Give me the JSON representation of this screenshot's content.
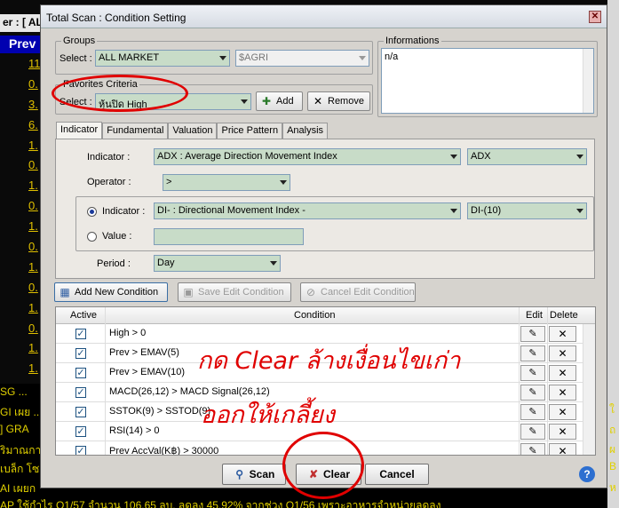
{
  "background": {
    "header_label": "er : [ AL",
    "prev_header": "Prev",
    "values": [
      "11.",
      "0.",
      "3.",
      "6.",
      "1.",
      "0.",
      "1.",
      "0.",
      "1.",
      "0.",
      "1.",
      "0.",
      "1.",
      "0.",
      "1.",
      "1."
    ],
    "news_lines": [
      "SG ...",
      "GI เผย ...",
      "] GRA",
      "ริมาณกา",
      "เบล็ก โซ",
      "AI เผยก",
      "AP ใช้กำไร Q1/57 จำนวน 106.65 ลบ. ลดลง 45.92% จากช่วง Q1/56 เพราะอาหารจำหน่ายลดลง"
    ],
    "right_news": [
      "ใ",
      "ถ",
      "ผ",
      "B",
      "ห"
    ]
  },
  "dialog": {
    "title": "Total Scan : Condition Setting",
    "close_glyph": "✕",
    "groups": {
      "title": "Groups",
      "select_label": "Select :",
      "market_value": "ALL MARKET",
      "sub_value": "$AGRI"
    },
    "informations": {
      "title": "Informations",
      "text": "n/a"
    },
    "favorites": {
      "title": "Favorites Criteria",
      "select_label": "Select :",
      "value": "หุ้นปิด High",
      "add_label": "Add",
      "remove_label": "Remove"
    },
    "tabs": [
      "Indicator",
      "Fundamental",
      "Valuation",
      "Price Pattern",
      "Analysis"
    ],
    "indicator_tab": {
      "indicator_label": "Indicator :",
      "indicator_value": "ADX : Average Direction Movement Index",
      "indicator_param": "ADX",
      "operator_label": "Operator :",
      "operator_value": ">",
      "radio_indicator_label": "Indicator :",
      "compare_indicator_value": "DI- : Directional Movement Index -",
      "compare_indicator_param": "DI-(10)",
      "radio_value_label": "Value :",
      "value_field": "",
      "period_label": "Period :",
      "period_value": "Day"
    },
    "actions": {
      "add_new": "Add New Condition",
      "save_edit": "Save Edit Condition",
      "cancel_edit": "Cancel Edit Condition"
    },
    "grid": {
      "headers": {
        "active": "Active",
        "condition": "Condition",
        "edit": "Edit",
        "delete": "Delete"
      },
      "rows": [
        {
          "active": true,
          "condition": "High > 0"
        },
        {
          "active": true,
          "condition": "Prev > EMAV(5)"
        },
        {
          "active": true,
          "condition": "Prev > EMAV(10)"
        },
        {
          "active": true,
          "condition": "MACD(26,12) > MACD Signal(26,12)"
        },
        {
          "active": true,
          "condition": "SSTOK(9) > SSTOD(9)"
        },
        {
          "active": true,
          "condition": "RSI(14) > 0"
        },
        {
          "active": true,
          "condition": "Prev AccVal(K฿) > 30000"
        }
      ]
    },
    "buttons": {
      "scan": "Scan",
      "clear": "Clear",
      "cancel": "Cancel",
      "help": "?"
    }
  },
  "annotation": {
    "line1": "กด Clear ล้างเงื่อนไขเก่า",
    "line2": "ออกให้เกลี้ยง",
    "color": "#e00000"
  }
}
